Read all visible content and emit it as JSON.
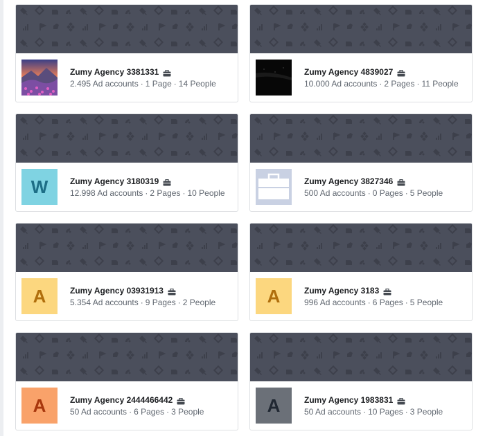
{
  "colors": {
    "cover_bg": "#4b4f5c",
    "cover_icon": "#3c3f4a",
    "name_text": "#1c1e21",
    "meta_text": "#606770"
  },
  "accounts": [
    {
      "name": "Zumy Agency 3381331",
      "ad_accounts": "2.495 Ad accounts",
      "pages": "1 Page",
      "people": "14 People",
      "avatar_type": "landscape-photo",
      "avatar_letter": "",
      "avatar_bg": "#7a6fb0",
      "avatar_fg": ""
    },
    {
      "name": "Zumy Agency 4839027",
      "ad_accounts": "10.000 Ad accounts",
      "pages": "2 Pages",
      "people": "11 People",
      "avatar_type": "dark-photo",
      "avatar_letter": "",
      "avatar_bg": "#0b0b0b",
      "avatar_fg": ""
    },
    {
      "name": "Zumy Agency 3180319",
      "ad_accounts": "12.998 Ad accounts",
      "pages": "2 Pages",
      "people": "10 People",
      "avatar_type": "letter",
      "avatar_letter": "W",
      "avatar_bg": "#7fd3e2",
      "avatar_fg": "#1d6e86"
    },
    {
      "name": "Zumy Agency 3827346",
      "ad_accounts": "500 Ad accounts",
      "pages": "0 Pages",
      "people": "5 People",
      "avatar_type": "briefcase-placeholder",
      "avatar_letter": "",
      "avatar_bg": "#c9d1e3",
      "avatar_fg": "#ffffff"
    },
    {
      "name": "Zumy Agency 03931913",
      "ad_accounts": "5.354 Ad accounts",
      "pages": "9 Pages",
      "people": "2 People",
      "avatar_type": "letter",
      "avatar_letter": "A",
      "avatar_bg": "#fcd77f",
      "avatar_fg": "#b06e0c"
    },
    {
      "name": "Zumy Agency 3183",
      "ad_accounts": "996 Ad accounts",
      "pages": "6 Pages",
      "people": "5 People",
      "avatar_type": "letter",
      "avatar_letter": "A",
      "avatar_bg": "#fcd77f",
      "avatar_fg": "#b06e0c"
    },
    {
      "name": "Zumy Agency 2444466442",
      "ad_accounts": "50 Ad accounts",
      "pages": "6 Pages",
      "people": "3 People",
      "avatar_type": "letter",
      "avatar_letter": "A",
      "avatar_bg": "#f9a26a",
      "avatar_fg": "#a8370d"
    },
    {
      "name": "Zumy Agency 1983831",
      "ad_accounts": "50 Ad accounts",
      "pages": "10 Pages",
      "people": "3 People",
      "avatar_type": "letter",
      "avatar_letter": "A",
      "avatar_bg": "#6b7078",
      "avatar_fg": "#202732"
    }
  ]
}
